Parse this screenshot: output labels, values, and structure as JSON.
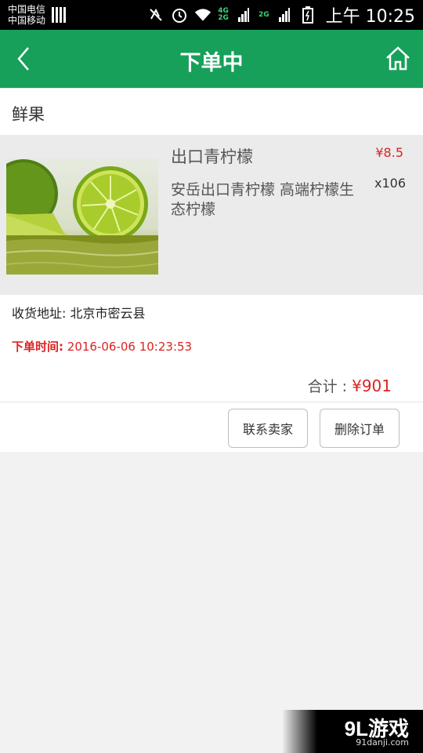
{
  "status_bar": {
    "carrier_1": "中国电信",
    "carrier_2": "中国移动",
    "network_4g": "4G",
    "network_2g": "2G",
    "network_2g_b": "2G",
    "time": "上午 10:25",
    "icons": [
      "sim-icon",
      "mute-icon",
      "alarm-icon",
      "wifi-icon",
      "signal-icon",
      "battery-icon"
    ]
  },
  "header": {
    "title": "下单中",
    "back_icon": "chevron-left-icon",
    "home_icon": "home-icon",
    "bg_color": "#16a05a"
  },
  "order": {
    "store_name": "鲜果",
    "product": {
      "name": "出口青柠檬",
      "price": "¥8.5",
      "description": "安岳出口青柠檬 高端柠檬生态柠檬",
      "quantity": "x106"
    },
    "address_label": "收货地址:",
    "address": "北京市密云县",
    "time_label": "下单时间:",
    "time_value": "2016-06-06 10:23:53",
    "total_label": "合计 :",
    "total_value": "¥901",
    "actions": {
      "contact_seller": "联系卖家",
      "delete_order": "删除订单"
    }
  },
  "watermark": {
    "brand": "9L游戏",
    "url": "91danji.com"
  },
  "colors": {
    "price_red": "#dd2222"
  }
}
